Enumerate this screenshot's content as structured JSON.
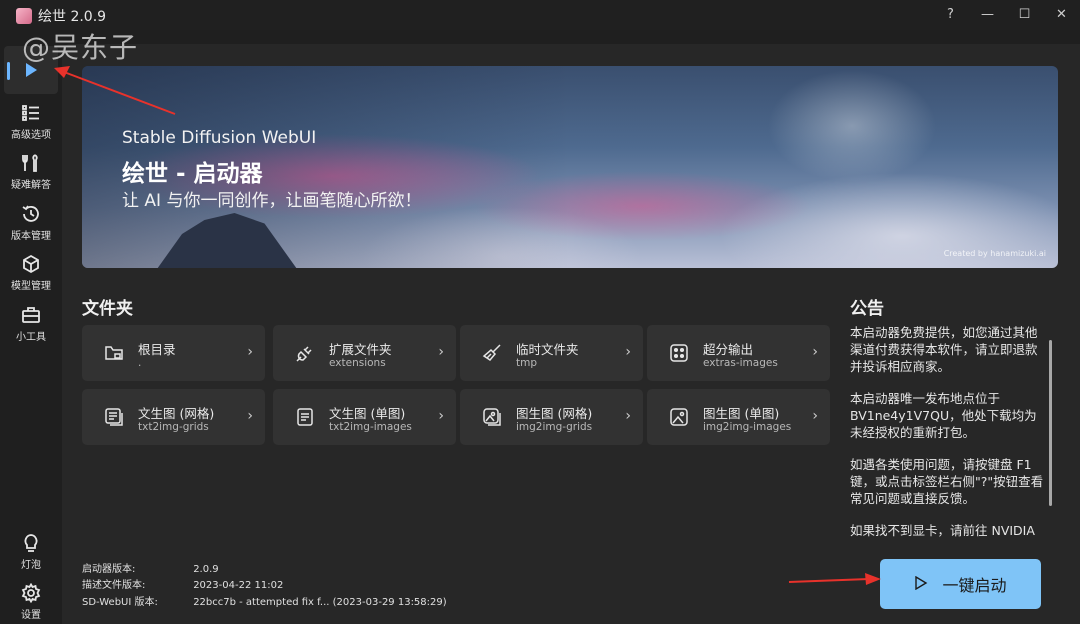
{
  "app": {
    "title": "绘世 2.0.9",
    "watermark": "@吴东子"
  },
  "window_controls": {
    "help": "?",
    "minimize": "—",
    "maximize": "☐",
    "close": "✕"
  },
  "sidebar": {
    "items": [
      {
        "label": "",
        "icon": "play-icon",
        "active": true
      },
      {
        "label": "高级选项",
        "icon": "list-icon"
      },
      {
        "label": "疑难解答",
        "icon": "tools-icon"
      },
      {
        "label": "版本管理",
        "icon": "history-icon"
      },
      {
        "label": "模型管理",
        "icon": "cube-icon"
      },
      {
        "label": "小工具",
        "icon": "toolbox-icon"
      }
    ],
    "bottom_items": [
      {
        "label": "灯泡",
        "icon": "lightbulb-icon"
      },
      {
        "label": "设置",
        "icon": "gear-icon"
      }
    ]
  },
  "banner": {
    "subtitle": "Stable Diffusion WebUI",
    "title": "绘世 - 启动器",
    "slogan": "让 AI 与你一同创作，让画笔随心所欲！",
    "credit": "Created by hanamizuki.ai"
  },
  "folders": {
    "title": "文件夹",
    "items": [
      {
        "title": "根目录",
        "sub": ".",
        "icon": "folder-icon"
      },
      {
        "title": "扩展文件夹",
        "sub": "extensions",
        "icon": "plug-icon"
      },
      {
        "title": "临时文件夹",
        "sub": "tmp",
        "icon": "broom-icon"
      },
      {
        "title": "超分输出",
        "sub": "extras-images",
        "icon": "dice-grid-icon"
      },
      {
        "title": "文生图 (网格)",
        "sub": "txt2img-grids",
        "icon": "text-grid-icon"
      },
      {
        "title": "文生图 (单图)",
        "sub": "txt2img-images",
        "icon": "text-doc-icon"
      },
      {
        "title": "图生图 (网格)",
        "sub": "img2img-grids",
        "icon": "image-grid-icon"
      },
      {
        "title": "图生图 (单图)",
        "sub": "img2img-images",
        "icon": "image-icon"
      }
    ]
  },
  "notice": {
    "title": "公告",
    "paragraphs": [
      "本启动器免费提供，如您通过其他渠道付费获得本软件，请立即退款并投诉相应商家。",
      "本启动器唯一发布地点位于 BV1ne4y1V7QU，他处下载均为未经授权的重新打包。",
      "如遇各类使用问题，请按键盘 F1 键，或点击标签栏右侧\"?\"按钮查看常见问题或直接反馈。",
      "如果找不到显卡，请前往 NVIDIA"
    ]
  },
  "info": {
    "rows": [
      {
        "label": "启动器版本:",
        "value": "2.0.9"
      },
      {
        "label": "描述文件版本:",
        "value": "2023-04-22 11:02"
      },
      {
        "label": "SD-WebUI 版本:",
        "value": "22bcc7b - attempted fix f... (2023-03-29 13:58:29)"
      }
    ]
  },
  "launch": {
    "label": "一键启动",
    "icon": "play-outline-icon"
  },
  "colors": {
    "accent": "#7fc4f7",
    "annotation_red": "#e8322b",
    "active_indicator": "#6cb6ff"
  }
}
